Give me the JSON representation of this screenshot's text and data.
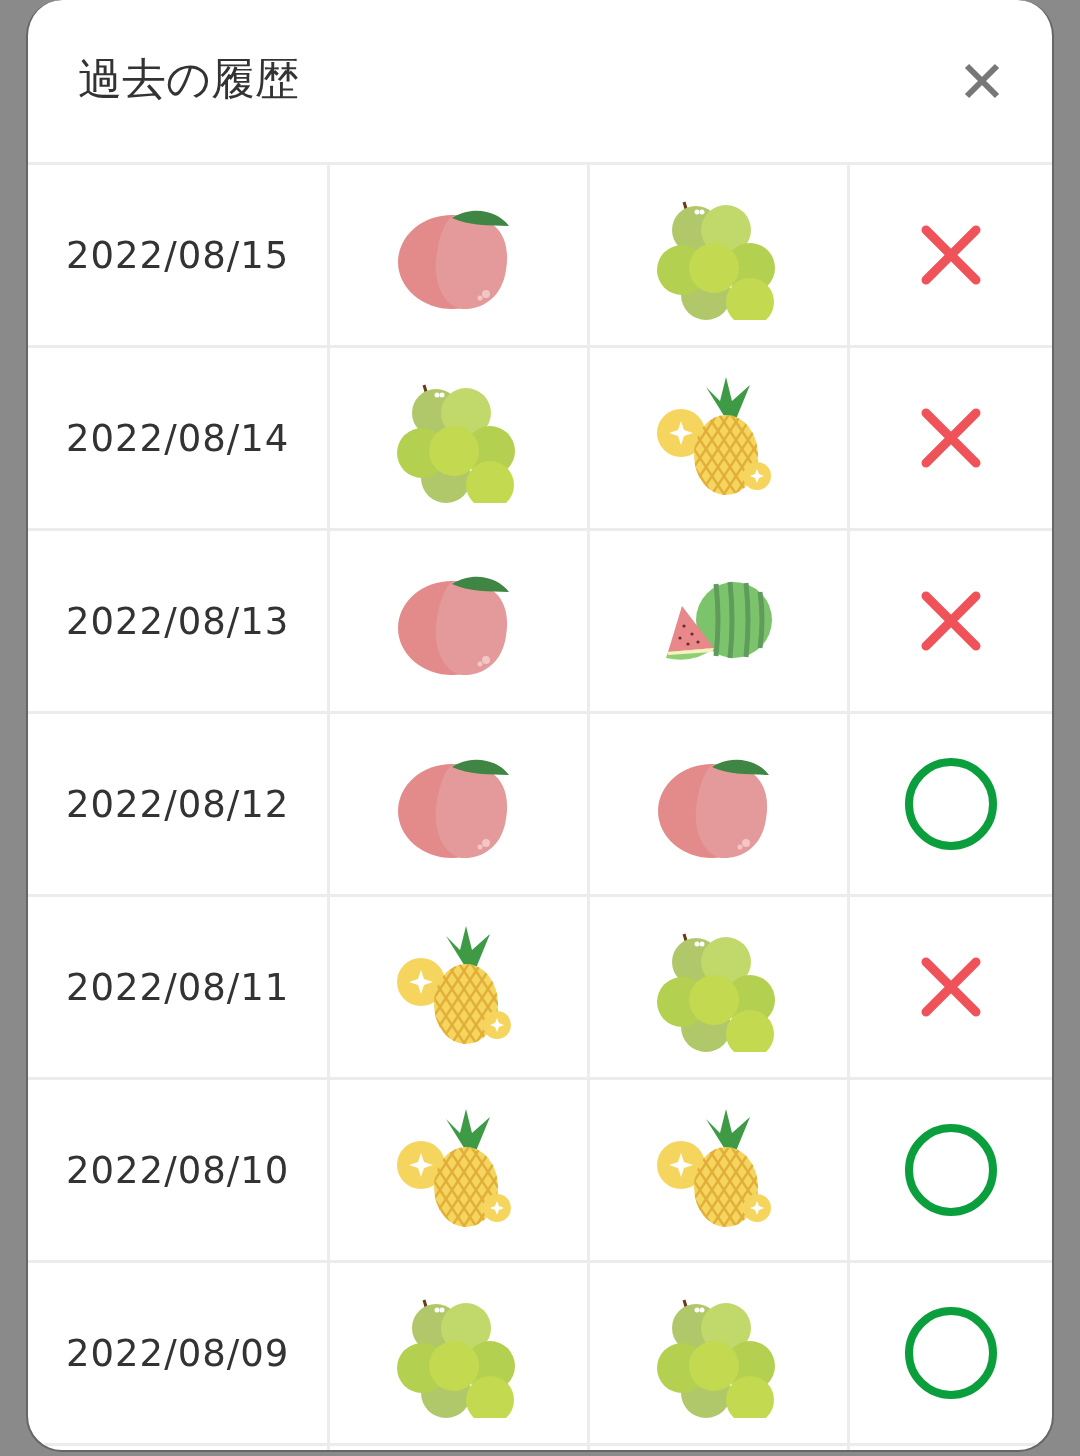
{
  "dialog": {
    "title": "過去の履歴"
  },
  "rows": [
    {
      "date": "2022/08/15",
      "fruits": [
        {
          "kind": "peach"
        },
        {
          "kind": "grapes"
        }
      ],
      "correct": false
    },
    {
      "date": "2022/08/14",
      "fruits": [
        {
          "kind": "grapes"
        },
        {
          "kind": "pineapple"
        }
      ],
      "correct": false
    },
    {
      "date": "2022/08/13",
      "fruits": [
        {
          "kind": "peach"
        },
        {
          "kind": "watermelon"
        }
      ],
      "correct": false
    },
    {
      "date": "2022/08/12",
      "fruits": [
        {
          "kind": "peach"
        },
        {
          "kind": "peach"
        }
      ],
      "correct": true
    },
    {
      "date": "2022/08/11",
      "fruits": [
        {
          "kind": "pineapple"
        },
        {
          "kind": "grapes"
        }
      ],
      "correct": false
    },
    {
      "date": "2022/08/10",
      "fruits": [
        {
          "kind": "pineapple"
        },
        {
          "kind": "pineapple"
        }
      ],
      "correct": true
    },
    {
      "date": "2022/08/09",
      "fruits": [
        {
          "kind": "grapes"
        },
        {
          "kind": "grapes"
        }
      ],
      "correct": true
    }
  ]
}
